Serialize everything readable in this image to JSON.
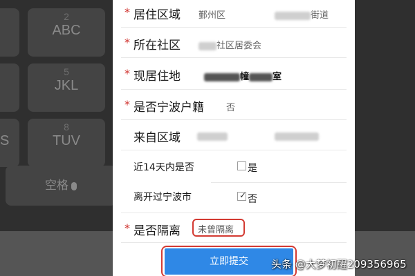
{
  "keyboard": {
    "keys": [
      {
        "num": "2",
        "letters": "ABC"
      },
      {
        "num": "5",
        "letters": "JKL"
      },
      {
        "num": "8",
        "letters": "TUV"
      },
      {
        "letters": "S"
      },
      {
        "letters": "空格"
      }
    ]
  },
  "form": {
    "residence_area": {
      "label": "居住区域",
      "district": "鄞州区",
      "street_suffix": "街道"
    },
    "community": {
      "label": "所在社区",
      "value_suffix": "社区居委会"
    },
    "current_address": {
      "label": "现居住地",
      "value_mid": "幢",
      "value_suffix": "室"
    },
    "ningbo_household": {
      "label": "是否宁波户籍",
      "value": "否"
    },
    "from_area": {
      "label": "来自区域"
    },
    "travel": {
      "label_line1": "近14天内是否",
      "label_line2": "离开过宁波市",
      "option_yes": "是",
      "option_no": "否",
      "selected": "否"
    },
    "quarantine": {
      "label": "是否隔离",
      "value": "未曾隔离"
    },
    "submit_label": "立即提交"
  },
  "watermark": "头条 @大梦初醒209356965",
  "colors": {
    "accent": "#2f88e6",
    "highlight": "#d33a32",
    "required": "#d0312d"
  }
}
